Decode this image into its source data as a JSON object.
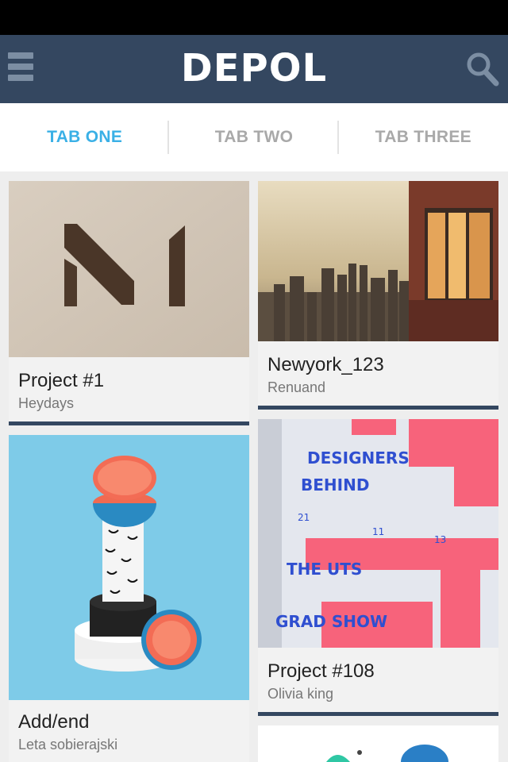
{
  "app": {
    "logo_text": "DEPOL",
    "menu_icon": "hamburger-menu-icon",
    "search_icon": "search-icon",
    "header_color": "#344760"
  },
  "tabs": [
    {
      "label": "TAB ONE",
      "active": true
    },
    {
      "label": "TAB TWO",
      "active": false
    },
    {
      "label": "TAB THREE",
      "active": false
    }
  ],
  "accent_color": "#3ab0e6",
  "cards": [
    {
      "title": "Project #1",
      "author": "Heydays",
      "image": "sculpture-letter-m-photo"
    },
    {
      "title": "Newyork_123",
      "author": "Renuand",
      "image": "new-york-skyline-photo"
    },
    {
      "title": "Add/end",
      "author": "Leta sobierajski",
      "image": "grapefruit-sculpture-photo"
    },
    {
      "title": "Project #108",
      "author": "Olivia king",
      "image": "designers-behind-poster-photo"
    },
    {
      "title": "",
      "author": "",
      "image": "abstract-shapes-illustration"
    }
  ]
}
